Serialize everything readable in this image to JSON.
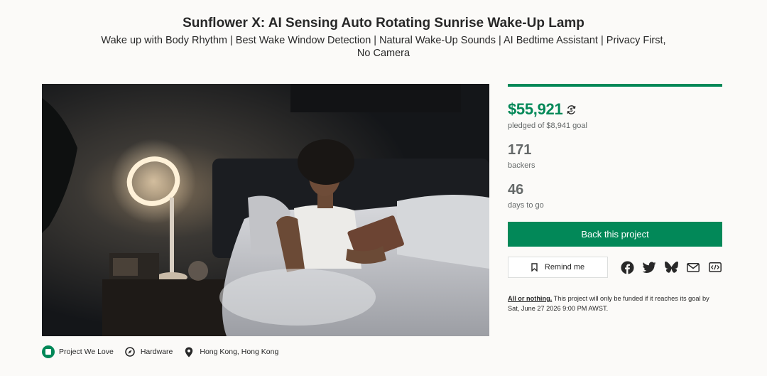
{
  "project": {
    "title": "Sunflower X: AI Sensing Auto Rotating Sunrise Wake-Up Lamp",
    "subtitle": "Wake up with Body Rhythm | Best Wake Window Detection | Natural Wake-Up Sounds | AI Bedtime Assistant | Privacy First, No Camera"
  },
  "tags": [
    {
      "label": "Project We Love",
      "icon": "project-we-love-badge"
    },
    {
      "label": "Hardware",
      "icon": "compass-icon"
    },
    {
      "label": "Hong Kong, Hong Kong",
      "icon": "location-pin-icon"
    }
  ],
  "funding": {
    "pledged": "$55,921",
    "goal_text": "pledged of $8,941 goal",
    "progress_fraction": 1.0,
    "currency_icon": "currency-conversion-icon"
  },
  "stats": {
    "backers_count": "171",
    "backers_label": "backers",
    "days_count": "46",
    "days_label": "days to go"
  },
  "actions": {
    "back_label": "Back this project",
    "remind_label": "Remind me",
    "share_icons": [
      "facebook-icon",
      "twitter-icon",
      "bluesky-icon",
      "email-icon",
      "embed-icon"
    ]
  },
  "terms": {
    "link_text": "All or nothing.",
    "text": "This project will only be funded if it reaches its goal by Sat, June 27 2026 9:00 PM AWST."
  },
  "colors": {
    "accent": "#028858",
    "muted_text": "#656969",
    "background": "#fbfaf8"
  }
}
